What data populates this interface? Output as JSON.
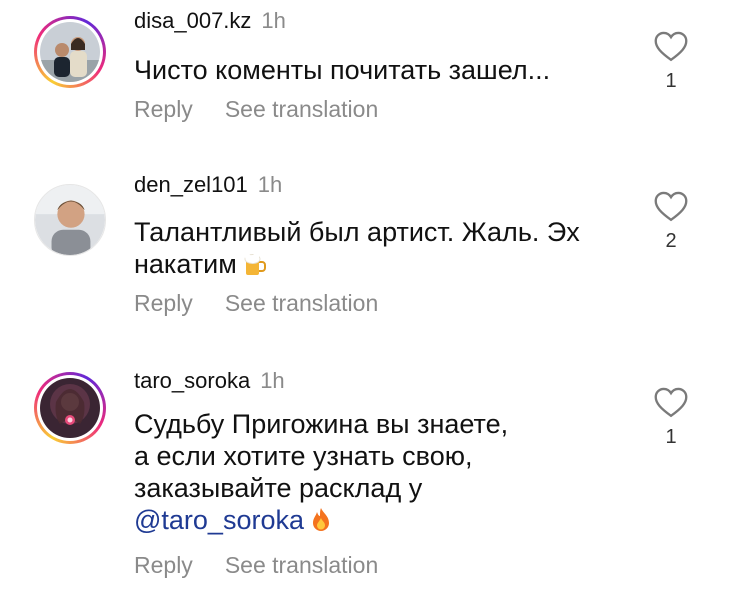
{
  "comments": [
    {
      "username": "disa_007.kz",
      "time": "1h",
      "text_lines": [
        "Чисто коменты почитать зашел..."
      ],
      "reply_label": "Reply",
      "translate_label": "See translation",
      "likes": "1",
      "story_ring": true,
      "emoji": null
    },
    {
      "username": "den_zel101",
      "time": "1h",
      "text_lines": [
        "Талантливый был артист. Жаль. Эх",
        "накатим"
      ],
      "reply_label": "Reply",
      "translate_label": "See translation",
      "likes": "2",
      "story_ring": false,
      "emoji": "beer-mug"
    },
    {
      "username": "taro_soroka",
      "time": "1h",
      "text_lines": [
        "Судьбу Пригожина вы знаете,",
        "а если хотите узнать свою,",
        "заказывайте расклад у"
      ],
      "mention": "@taro_soroka",
      "reply_label": "Reply",
      "translate_label": "See translation",
      "likes": "1",
      "story_ring": true,
      "emoji": "fire"
    }
  ],
  "colors": {
    "mention": "#1f3a93",
    "muted": "#8a8a8a",
    "ring_start": "#f9ce34",
    "ring_mid": "#ee2a7b",
    "ring_end": "#6228d7"
  }
}
